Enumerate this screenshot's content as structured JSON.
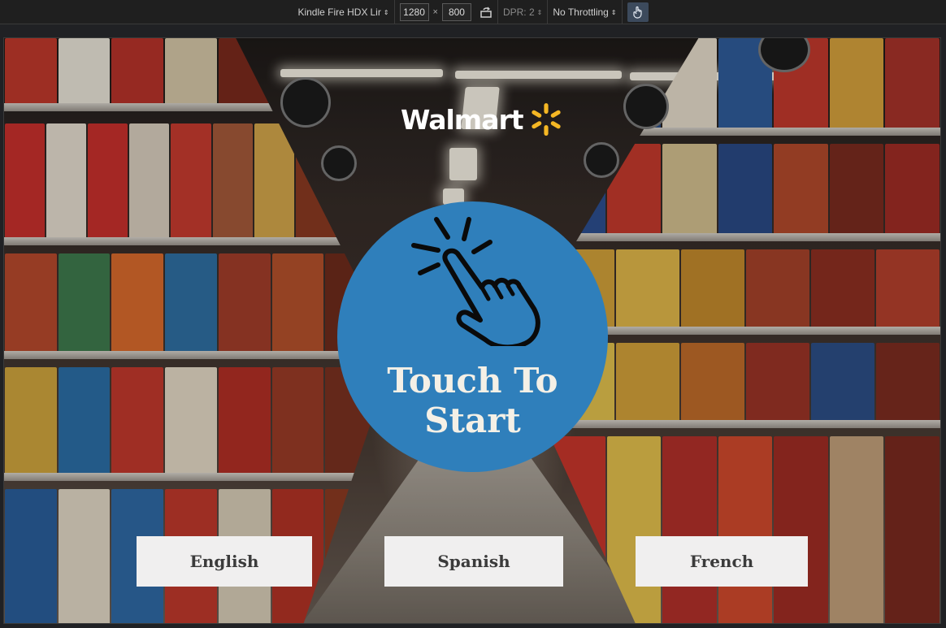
{
  "devtools": {
    "device_name": "Kindle Fire HDX",
    "orientation_partial": "Lir",
    "width": "1280",
    "height": "800",
    "dpr_label": "DPR: 2",
    "throttling": "No Throttling"
  },
  "app": {
    "logo_text": "Walmart",
    "logo_icon": "spark-icon",
    "start_icon": "tap-hand-icon",
    "start_label": "Touch To Start",
    "languages": [
      {
        "label": "English"
      },
      {
        "label": "Spanish"
      },
      {
        "label": "French"
      }
    ]
  },
  "colors": {
    "circle": "#2f7fbb",
    "spark": "#f5b724",
    "button_bg": "#f0efef",
    "button_text": "#3b3b3b"
  }
}
